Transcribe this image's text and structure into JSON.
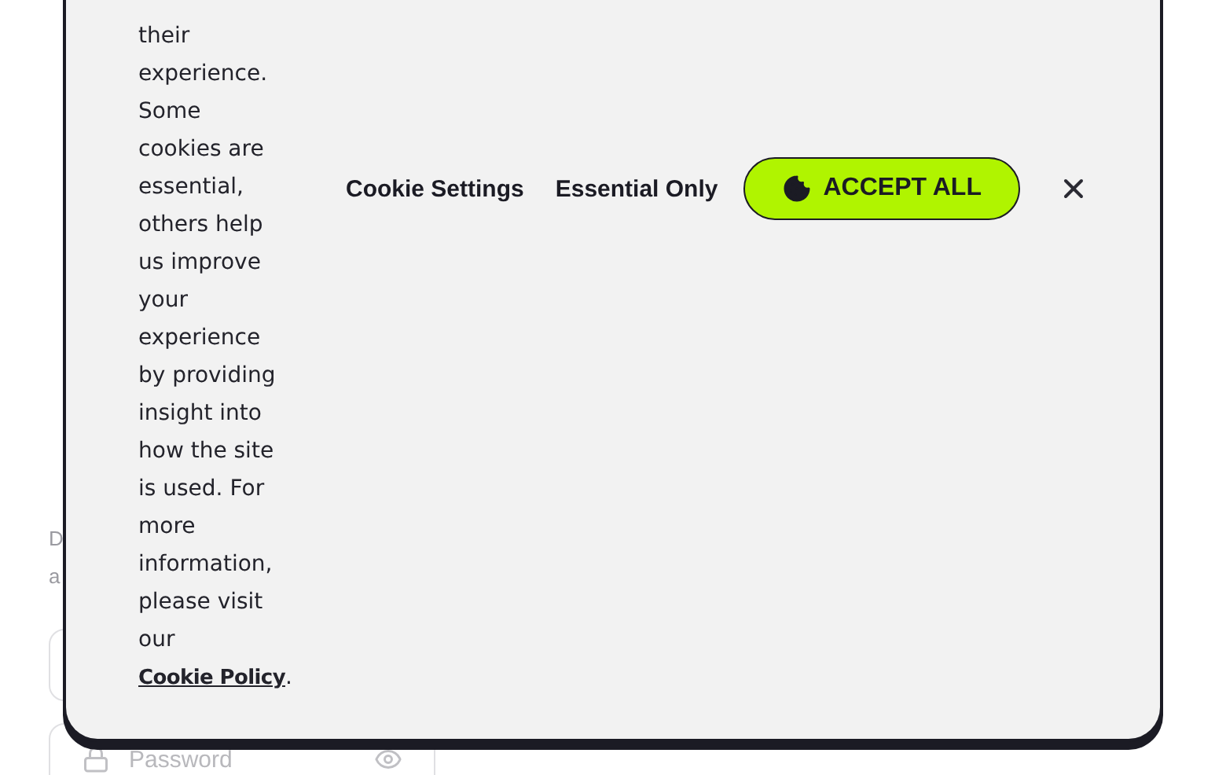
{
  "page": {
    "text_fragments": [
      "D",
      "a"
    ],
    "password_field": {
      "placeholder": "Password"
    }
  },
  "cookie_banner": {
    "message": "their experience. Some cookies are essential, others help us improve your experience by providing insight into how the site is used. For more information, please visit our",
    "policy_link": "Cookie Policy",
    "message_end": ".",
    "buttons": [
      {
        "kind": "text",
        "label": "Cookie Settings"
      },
      {
        "kind": "text",
        "label": "Essential Only"
      },
      {
        "kind": "primary",
        "label": "ACCEPT ALL"
      }
    ]
  }
}
